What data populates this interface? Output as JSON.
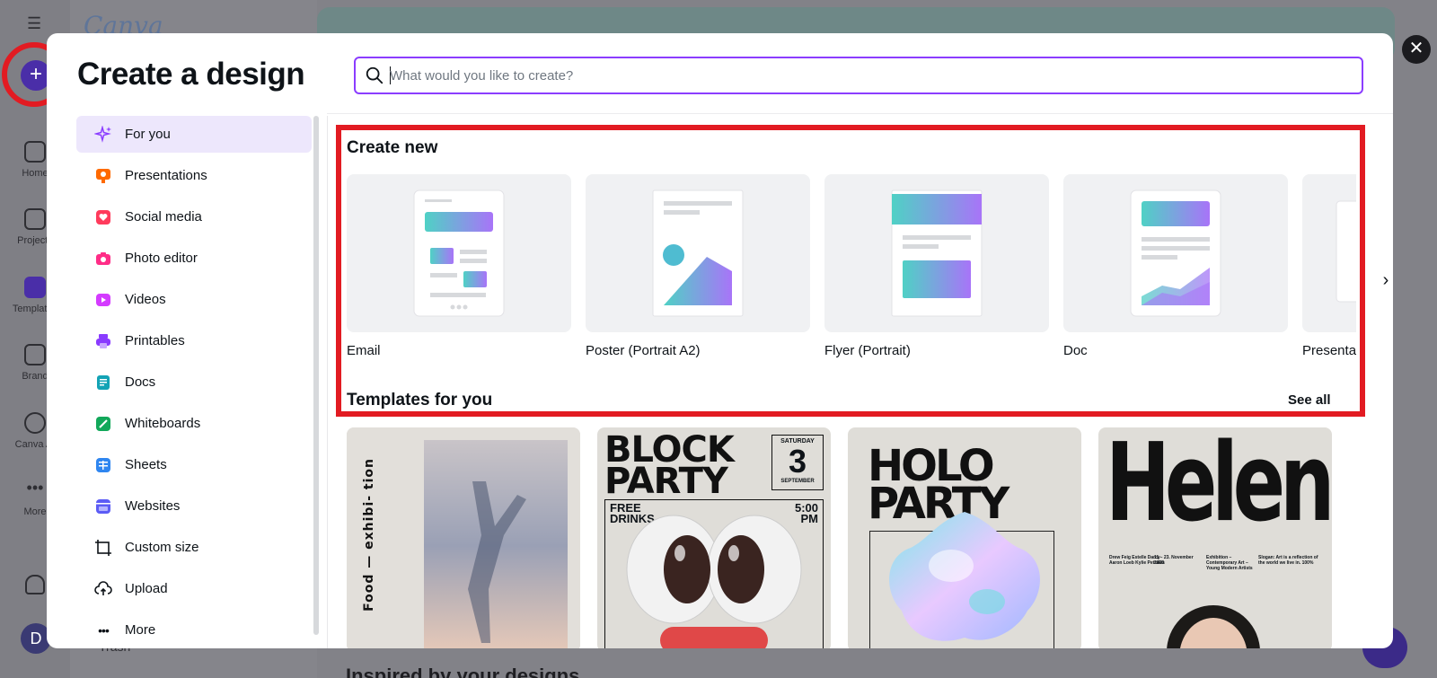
{
  "background": {
    "logo": "Canva",
    "nav": [
      {
        "label": "Home",
        "icon": "home-icon"
      },
      {
        "label": "Projects",
        "icon": "folder-icon"
      },
      {
        "label": "Templates",
        "icon": "templates-icon"
      },
      {
        "label": "Brand",
        "icon": "brand-icon"
      },
      {
        "label": "Canva AI",
        "icon": "canva-ai-icon"
      },
      {
        "label": "More",
        "icon": "more-icon"
      }
    ],
    "avatar": "D",
    "trash": "Trash",
    "inspired_heading": "Inspired by your designs"
  },
  "modal": {
    "title": "Create a design",
    "search": {
      "placeholder": "What would you like to create?",
      "value": ""
    },
    "close_label": "✕",
    "nav": [
      {
        "label": "For you",
        "icon": "sparkle-icon",
        "color": "#8b3dff",
        "active": true
      },
      {
        "label": "Presentations",
        "icon": "presentation-icon",
        "color": "#ff6a00"
      },
      {
        "label": "Social media",
        "icon": "heart-icon",
        "color": "#ff3b5c"
      },
      {
        "label": "Photo editor",
        "icon": "camera-icon",
        "color": "#ff2d87"
      },
      {
        "label": "Videos",
        "icon": "video-icon",
        "color": "#d43bff"
      },
      {
        "label": "Printables",
        "icon": "printer-icon",
        "color": "#8a3bff"
      },
      {
        "label": "Docs",
        "icon": "doc-icon",
        "color": "#13a3b5"
      },
      {
        "label": "Whiteboards",
        "icon": "whiteboard-icon",
        "color": "#12a85a"
      },
      {
        "label": "Sheets",
        "icon": "sheet-icon",
        "color": "#2f86f0"
      },
      {
        "label": "Websites",
        "icon": "website-icon",
        "color": "#5c5cf5"
      },
      {
        "label": "Custom size",
        "icon": "crop-icon",
        "color": "#0e1318"
      },
      {
        "label": "Upload",
        "icon": "upload-icon",
        "color": "#0e1318"
      },
      {
        "label": "More",
        "icon": "more-icon",
        "color": "#0e1318"
      }
    ],
    "create_new": {
      "title": "Create new",
      "cards": [
        {
          "label": "Email",
          "icon": "email-thumbnail"
        },
        {
          "label": "Poster (Portrait A2)",
          "icon": "poster-thumbnail"
        },
        {
          "label": "Flyer (Portrait)",
          "icon": "flyer-thumbnail"
        },
        {
          "label": "Doc",
          "icon": "doc-thumbnail"
        },
        {
          "label": "Presentation",
          "icon": "presentation-thumbnail"
        }
      ]
    },
    "templates": {
      "title": "Templates for you",
      "see_all": "See all",
      "items": [
        {
          "text": "Food — exhibi- tion"
        },
        {
          "title": "BLOCK PARTY",
          "day": "SATURDAY",
          "date": "3",
          "month": "SEPTEMBER",
          "sub_left": "FREE DRINKS",
          "time": "5:00 PM"
        },
        {
          "title": "HOLO PARTY"
        },
        {
          "title": "Helene",
          "col1": "Drew Feig Estelle Darcy Aaron Loeb Kylie Petrakis",
          "col2": "Exhibition – Contemporary Art – Young Modern Artists",
          "col3": "Slogan: Art is a reflection of the world we live in. 100%",
          "dates": "11 – 23. November 2030"
        }
      ]
    }
  },
  "colors": {
    "accent": "#8b3dff",
    "highlight": "#e21b22",
    "active_bg": "#ede7fc"
  }
}
